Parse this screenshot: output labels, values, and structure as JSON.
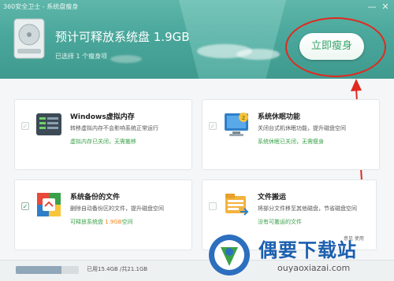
{
  "window": {
    "title": "360安全卫士 - 系统盘瘦身",
    "minimize_glyph": "—",
    "close_glyph": "✕"
  },
  "header": {
    "title": "预计可释放系统盘 1.9GB",
    "subtitle": "已选择 1 个瘦身项",
    "action_label": "立即瘦身"
  },
  "cards": [
    {
      "title": "Windows虚拟内存",
      "desc": "转移虚拟内存不会影响系统正常运行",
      "status": "虚拟内存已关闭，无需搬移",
      "checked": false,
      "icon": "virtual-memory-icon"
    },
    {
      "title": "系统休眠功能",
      "desc": "关闭台式机休眠功能，提升磁盘空间",
      "status": "系统休眠已关闭，无需瘦身",
      "checked": false,
      "icon": "hibernate-icon"
    },
    {
      "title": "系统备份的文件",
      "desc": "删除自动备份区的文件，提升磁盘空间",
      "status_prefix": "可释放系统盘",
      "status_value": "1.9GB",
      "status_suffix": "空间",
      "checked": true,
      "icon": "system-backup-icon"
    },
    {
      "title": "文件搬运",
      "desc": "将部分文件移至其他磁盘，节省磁盘空间",
      "status": "没有可搬运的文件",
      "checked": false,
      "icon": "file-move-icon"
    }
  ],
  "footer": {
    "usage_text": "已用15.4GB /共21.1GB",
    "usage_fraction": 0.73,
    "links": "意见  使用"
  },
  "watermark": {
    "name": "偶要下载站",
    "url": "ouyaoxiazai.com"
  },
  "colors": {
    "header": "#4aa79b",
    "accent_green": "#37a46a",
    "status_green": "#3aa149",
    "highlight_orange": "#f0821e",
    "annotation_red": "#e02a1f",
    "watermark_blue": "#1b5fb0"
  }
}
